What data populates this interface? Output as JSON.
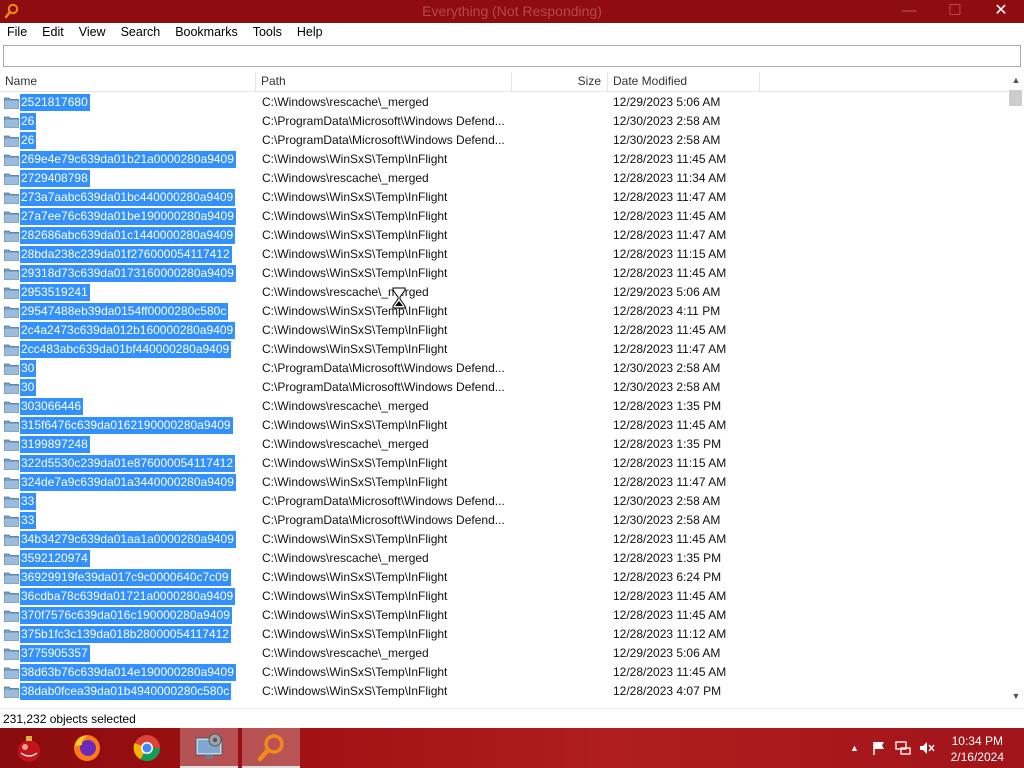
{
  "window": {
    "title": "Everything (Not Responding)",
    "minimize": "—",
    "maximize": "☐",
    "close": "✕"
  },
  "menu": [
    "File",
    "Edit",
    "View",
    "Search",
    "Bookmarks",
    "Tools",
    "Help"
  ],
  "search": {
    "value": ""
  },
  "columns": {
    "name": "Name",
    "path": "Path",
    "size": "Size",
    "date": "Date Modified"
  },
  "rows": [
    {
      "name": "2521817680",
      "path": "C:\\Windows\\rescache\\_merged",
      "date": "12/29/2023 5:06 AM"
    },
    {
      "name": "26",
      "path": "C:\\ProgramData\\Microsoft\\Windows Defend...",
      "date": "12/30/2023 2:58 AM"
    },
    {
      "name": "26",
      "path": "C:\\ProgramData\\Microsoft\\Windows Defend...",
      "date": "12/30/2023 2:58 AM"
    },
    {
      "name": "269e4e79c639da01b21a0000280a9409",
      "path": "C:\\Windows\\WinSxS\\Temp\\InFlight",
      "date": "12/28/2023 11:45 AM"
    },
    {
      "name": "2729408798",
      "path": "C:\\Windows\\rescache\\_merged",
      "date": "12/28/2023 11:34 AM"
    },
    {
      "name": "273a7aabc639da01bc440000280a9409",
      "path": "C:\\Windows\\WinSxS\\Temp\\InFlight",
      "date": "12/28/2023 11:47 AM"
    },
    {
      "name": "27a7ee76c639da01be190000280a9409",
      "path": "C:\\Windows\\WinSxS\\Temp\\InFlight",
      "date": "12/28/2023 11:45 AM"
    },
    {
      "name": "282686abc639da01c1440000280a9409",
      "path": "C:\\Windows\\WinSxS\\Temp\\InFlight",
      "date": "12/28/2023 11:47 AM"
    },
    {
      "name": "28bda238c239da01f276000054117412",
      "path": "C:\\Windows\\WinSxS\\Temp\\InFlight",
      "date": "12/28/2023 11:15 AM"
    },
    {
      "name": "29318d73c639da0173160000280a9409",
      "path": "C:\\Windows\\WinSxS\\Temp\\InFlight",
      "date": "12/28/2023 11:45 AM"
    },
    {
      "name": "2953519241",
      "path": "C:\\Windows\\rescache\\_merged",
      "date": "12/29/2023 5:06 AM"
    },
    {
      "name": "29547488eb39da0154ff0000280c580c",
      "path": "C:\\Windows\\WinSxS\\Temp\\InFlight",
      "date": "12/28/2023 4:11 PM"
    },
    {
      "name": "2c4a2473c639da012b160000280a9409",
      "path": "C:\\Windows\\WinSxS\\Temp\\InFlight",
      "date": "12/28/2023 11:45 AM"
    },
    {
      "name": "2cc483abc639da01bf440000280a9409",
      "path": "C:\\Windows\\WinSxS\\Temp\\InFlight",
      "date": "12/28/2023 11:47 AM"
    },
    {
      "name": "30",
      "path": "C:\\ProgramData\\Microsoft\\Windows Defend...",
      "date": "12/30/2023 2:58 AM"
    },
    {
      "name": "30",
      "path": "C:\\ProgramData\\Microsoft\\Windows Defend...",
      "date": "12/30/2023 2:58 AM"
    },
    {
      "name": "303066446",
      "path": "C:\\Windows\\rescache\\_merged",
      "date": "12/28/2023 1:35 PM"
    },
    {
      "name": "315f6476c639da0162190000280a9409",
      "path": "C:\\Windows\\WinSxS\\Temp\\InFlight",
      "date": "12/28/2023 11:45 AM"
    },
    {
      "name": "3199897248",
      "path": "C:\\Windows\\rescache\\_merged",
      "date": "12/28/2023 1:35 PM"
    },
    {
      "name": "322d5530c239da01e876000054117412",
      "path": "C:\\Windows\\WinSxS\\Temp\\InFlight",
      "date": "12/28/2023 11:15 AM"
    },
    {
      "name": "324de7a9c639da01a3440000280a9409",
      "path": "C:\\Windows\\WinSxS\\Temp\\InFlight",
      "date": "12/28/2023 11:47 AM"
    },
    {
      "name": "33",
      "path": "C:\\ProgramData\\Microsoft\\Windows Defend...",
      "date": "12/30/2023 2:58 AM"
    },
    {
      "name": "33",
      "path": "C:\\ProgramData\\Microsoft\\Windows Defend...",
      "date": "12/30/2023 2:58 AM"
    },
    {
      "name": "34b34279c639da01aa1a0000280a9409",
      "path": "C:\\Windows\\WinSxS\\Temp\\InFlight",
      "date": "12/28/2023 11:45 AM"
    },
    {
      "name": "3592120974",
      "path": "C:\\Windows\\rescache\\_merged",
      "date": "12/28/2023 1:35 PM"
    },
    {
      "name": "36929919fe39da017c9c0000640c7c09",
      "path": "C:\\Windows\\WinSxS\\Temp\\InFlight",
      "date": "12/28/2023 6:24 PM"
    },
    {
      "name": "36cdba78c639da01721a0000280a9409",
      "path": "C:\\Windows\\WinSxS\\Temp\\InFlight",
      "date": "12/28/2023 11:45 AM"
    },
    {
      "name": "370f7576c639da016c190000280a9409",
      "path": "C:\\Windows\\WinSxS\\Temp\\InFlight",
      "date": "12/28/2023 11:45 AM"
    },
    {
      "name": "375b1fc3c139da018b28000054117412",
      "path": "C:\\Windows\\WinSxS\\Temp\\InFlight",
      "date": "12/28/2023 11:12 AM"
    },
    {
      "name": "3775905357",
      "path": "C:\\Windows\\rescache\\_merged",
      "date": "12/29/2023 5:06 AM"
    },
    {
      "name": "38d63b76c639da014e190000280a9409",
      "path": "C:\\Windows\\WinSxS\\Temp\\InFlight",
      "date": "12/28/2023 11:45 AM"
    },
    {
      "name": "38dab0fcea39da01b4940000280c580c",
      "path": "C:\\Windows\\WinSxS\\Temp\\InFlight",
      "date": "12/28/2023 4:07 PM"
    }
  ],
  "status": {
    "text": "231,232 objects selected"
  },
  "taskbar": {
    "apps": [
      "christmas-ornament-icon",
      "firefox-icon",
      "chrome-icon",
      "control-panel-icon",
      "everything-search-icon"
    ],
    "clock": {
      "time": "10:34 PM",
      "date": "2/16/2024"
    }
  },
  "colors": {
    "titlebar": "#8f0c10",
    "selection": "#3390ff",
    "taskbar": "#a01214",
    "folder": "#7aa3c8"
  }
}
